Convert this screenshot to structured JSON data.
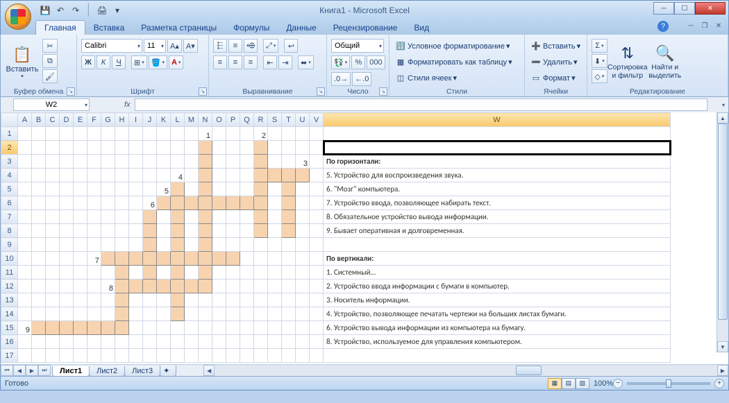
{
  "app": {
    "title": "Книга1 - Microsoft Excel"
  },
  "qat": {
    "save": "💾",
    "undo": "↶",
    "redo": "↷",
    "print": "🖨"
  },
  "tabs": {
    "home": "Главная",
    "insert": "Вставка",
    "layout": "Разметка страницы",
    "formulas": "Формулы",
    "data": "Данные",
    "review": "Рецензирование",
    "view": "Вид"
  },
  "ribbon": {
    "clipboard": {
      "label": "Буфер обмена",
      "paste": "Вставить"
    },
    "font": {
      "label": "Шрифт",
      "name": "Calibri",
      "size": "11",
      "bold": "Ж",
      "italic": "К",
      "underline": "Ч"
    },
    "align": {
      "label": "Выравнивание"
    },
    "number": {
      "label": "Число",
      "format": "Общий"
    },
    "styles": {
      "label": "Стили",
      "cond": "Условное форматирование",
      "table": "Форматировать как таблицу",
      "cell": "Стили ячеек"
    },
    "cells": {
      "label": "Ячейки",
      "insert": "Вставить",
      "delete": "Удалить",
      "format": "Формат"
    },
    "editing": {
      "label": "Редактирование",
      "sort": "Сортировка и фильтр",
      "find": "Найти и выделить"
    }
  },
  "fx": {
    "namebox": "W2",
    "label": "fx"
  },
  "columns": [
    "A",
    "B",
    "C",
    "D",
    "E",
    "F",
    "G",
    "H",
    "I",
    "J",
    "K",
    "L",
    "M",
    "N",
    "O",
    "P",
    "Q",
    "R",
    "S",
    "T",
    "U",
    "V",
    "W"
  ],
  "rows": 17,
  "active_col": "W",
  "active_row": 2,
  "crossword": {
    "cells": [
      "N2",
      "R2",
      "N3",
      "R3",
      "N4",
      "R4",
      "S4",
      "T4",
      "U4",
      "L5",
      "N5",
      "R5",
      "T5",
      "K6",
      "L6",
      "M6",
      "N6",
      "O6",
      "P6",
      "Q6",
      "R6",
      "T6",
      "J7",
      "L7",
      "N7",
      "R7",
      "T7",
      "J8",
      "L8",
      "N8",
      "R8",
      "T8",
      "J9",
      "L9",
      "N9",
      "G10",
      "H10",
      "I10",
      "J10",
      "K10",
      "L10",
      "M10",
      "N10",
      "O10",
      "P10",
      "H11",
      "J11",
      "L11",
      "N11",
      "H12",
      "I12",
      "J12",
      "K12",
      "L12",
      "M12",
      "N12",
      "H13",
      "L13",
      "H14",
      "L14",
      "B15",
      "C15",
      "D15",
      "E15",
      "F15",
      "G15",
      "H15"
    ],
    "numbers": {
      "N1": "1",
      "R1": "2",
      "U3": "3",
      "L4": "4",
      "K5": "5",
      "J6": "6",
      "F10": "7",
      "G12": "8",
      "A15": "9"
    }
  },
  "clues": {
    "h_title": "По горизонтали:",
    "h": [
      "5. Устройство для воспроизведения звука.",
      "6. \"Мозг\" компьютера.",
      "7. Устройство ввода, позволяющее набирать текст.",
      "8. Обязательное устройство вывода информации.",
      "9. Бывает оперативная и долговременная."
    ],
    "v_title": "По вертикали:",
    "v": [
      "1. Системный…",
      "2. Устройство ввода информации с бумаги в компьютер.",
      "3. Носитель информации.",
      "4. Устройство, позволяющее печатать чертежи на больших листах бумаги.",
      "6. Устройство вывода информации из компьютера на бумагу.",
      "8. Устройство, используемое для управления компьютером."
    ]
  },
  "sheets": {
    "s1": "Лист1",
    "s2": "Лист2",
    "s3": "Лист3"
  },
  "status": {
    "ready": "Готово",
    "zoom": "100%"
  }
}
